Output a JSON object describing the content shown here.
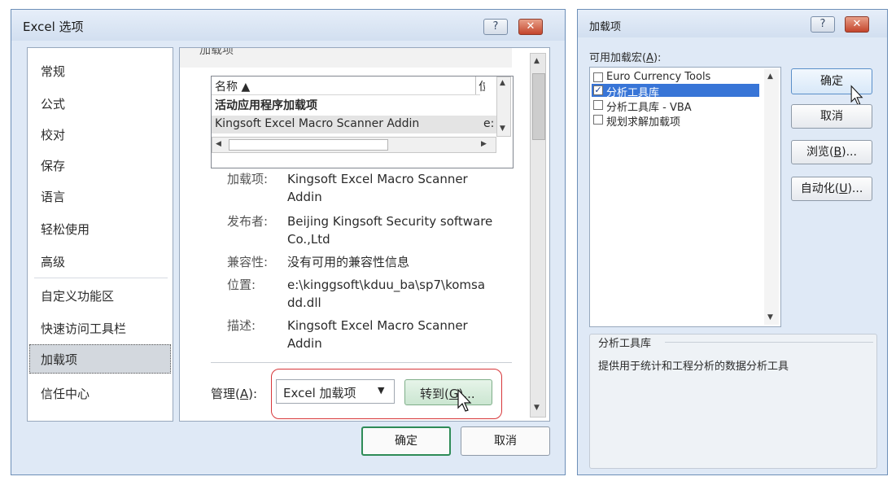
{
  "options_dialog": {
    "title": "Excel 选项",
    "help_glyph": "?",
    "close_glyph": "✕",
    "nav_items": [
      "常规",
      "公式",
      "校对",
      "保存",
      "语言",
      "轻松使用",
      "高级",
      "自定义功能区",
      "快速访问工具栏",
      "加载项",
      "信任中心"
    ],
    "selected_nav": "加载项",
    "section_header": "加载项",
    "table": {
      "col_name": "名称 ▲",
      "col_loc": "位",
      "group_label": "活动应用程序加载项",
      "selected_row_name": "Kingsoft Excel Macro Scanner Addin",
      "selected_row_loc": "e:"
    },
    "details": [
      {
        "label": "加载项:",
        "value": "Kingsoft Excel Macro Scanner Addin"
      },
      {
        "label": "发布者:",
        "value": "Beijing Kingsoft Security software Co.,Ltd"
      },
      {
        "label": "兼容性:",
        "value": "没有可用的兼容性信息"
      },
      {
        "label": "位置:",
        "value": "e:\\kinggsoft\\kduu_ba\\sp7\\komsadd.dll"
      },
      {
        "label": "描述:",
        "value": "Kingsoft Excel Macro Scanner Addin"
      }
    ],
    "manage_label_pre": "管理(",
    "manage_label_key": "A",
    "manage_label_post": "):",
    "manage_select_value": "Excel 加载项",
    "goto_pre": "转到(",
    "goto_key": "G",
    "goto_post": ")...",
    "ok_label": "确定",
    "cancel_label": "取消",
    "colors": {
      "accent_green": "#2e8b57",
      "highlight_red": "#d7373a"
    }
  },
  "addins_dialog": {
    "title": "加载项",
    "help_glyph": "?",
    "close_glyph": "✕",
    "available_label_pre": "可用加载宏(",
    "available_label_key": "A",
    "available_label_post": "):",
    "items": [
      {
        "name": "Euro Currency Tools",
        "checked": false
      },
      {
        "name": "分析工具库",
        "checked": true
      },
      {
        "name": "分析工具库 - VBA",
        "checked": false
      },
      {
        "name": "规划求解加载项",
        "checked": false
      }
    ],
    "checkmark": "✓",
    "ok_label": "确定",
    "cancel_label": "取消",
    "browse_pre": "浏览(",
    "browse_key": "B",
    "browse_post": ")...",
    "automation_pre": "自动化(",
    "automation_key": "U",
    "automation_post": ")...",
    "group_title": "分析工具库",
    "description": "提供用于统计和工程分析的数据分析工具"
  }
}
